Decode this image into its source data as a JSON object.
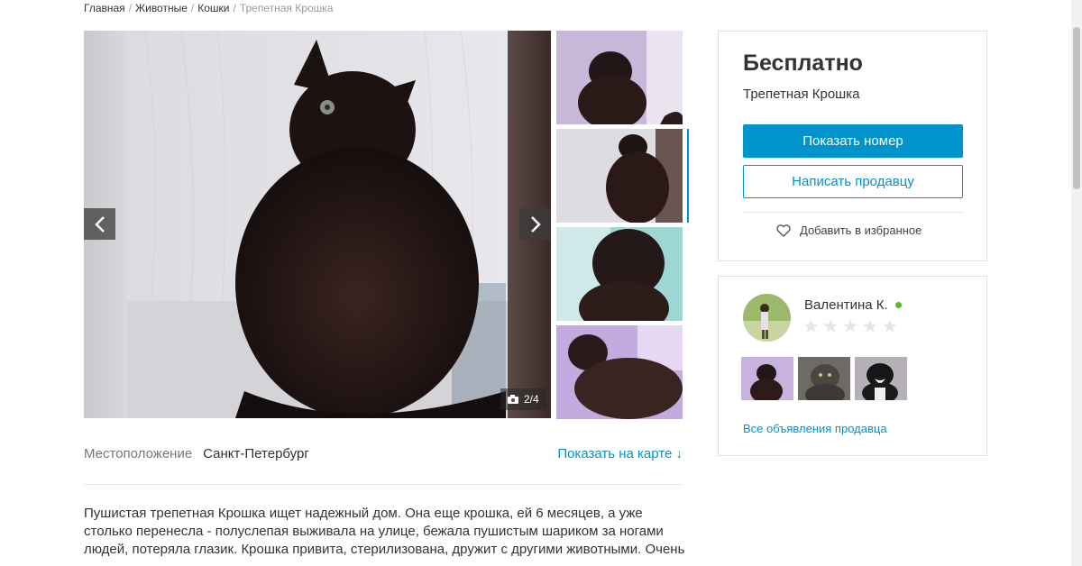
{
  "breadcrumb": {
    "items": [
      "Главная",
      "Животные",
      "Кошки"
    ],
    "current": "Трепетная Крошка",
    "separator": "/"
  },
  "gallery": {
    "counter": "2/4",
    "prev_icon": "chevron-left-icon",
    "next_icon": "chevron-right-icon",
    "camera_icon": "camera-icon",
    "active_thumb": 2,
    "thumb_count": 4
  },
  "location": {
    "label": "Местоположение",
    "value": "Санкт-Петербург",
    "map_link": "Показать на карте ↓"
  },
  "description": "Пушистая трепетная Крошка ищет надежный дом. Она еще крошка, ей 6 месяцев, а уже столько перенесла - полуслепая выживала на улице, бежала пушистым шариком за ногами людей, потеряла глазик. Крошка привита, стерилизована, дружит с другими животными. Очень",
  "price_card": {
    "price": "Бесплатно",
    "title": "Трепетная Крошка",
    "show_phone": "Показать номер",
    "write_seller": "Написать продавцу",
    "add_favorite": "Добавить в избранное"
  },
  "seller": {
    "name": "Валентина К.",
    "online": true,
    "rating": 0,
    "stars": [
      "★",
      "★",
      "★",
      "★",
      "★"
    ],
    "all_ads": "Все объявления продавца"
  },
  "colors": {
    "accent": "#0093cc",
    "online": "#58b92e",
    "star_empty": "#e6e6e6"
  }
}
